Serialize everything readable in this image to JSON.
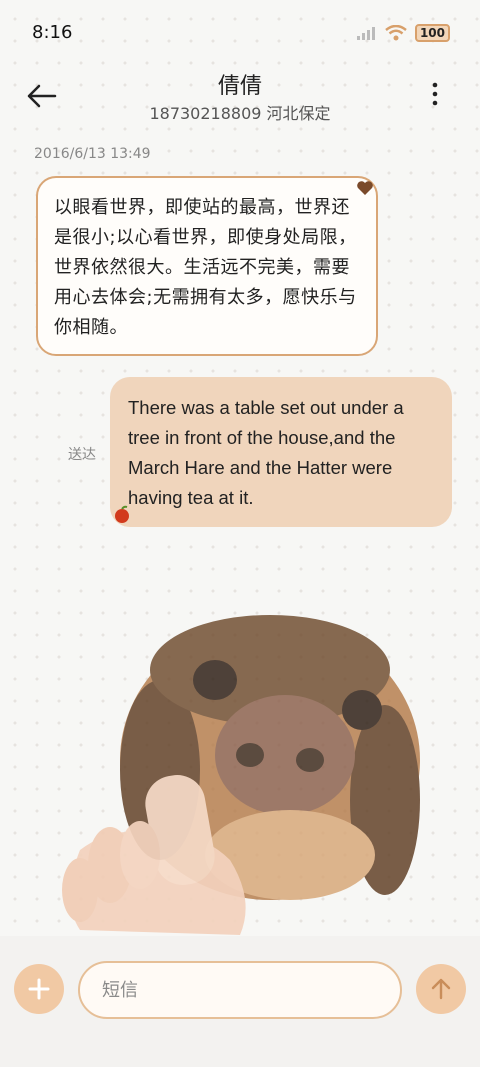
{
  "status_bar": {
    "time": "8:16",
    "battery": "100",
    "icons": [
      "signal-icon",
      "wifi-icon",
      "battery-icon"
    ]
  },
  "header": {
    "title": "倩倩",
    "subtitle": "18730218809 河北保定",
    "back_icon": "arrow-left-icon",
    "more_icon": "more-vertical-icon"
  },
  "messages": {
    "timestamp": "2016/6/13 13:49",
    "incoming_text": "以眼看世界，即使站的最高，世界还是很小;以心看世界，即使身处局限，世界依然很大。生活远不完美，需要用心去体会;无需拥有太多，愿快乐与你相随。",
    "outgoing_status": "送达",
    "outgoing_text": "There was a table set out under a tree in front of the house,and the March Hare and the Hatter were having tea at it."
  },
  "composer": {
    "placeholder": "短信",
    "add_icon": "plus-icon",
    "send_icon": "arrow-up-icon"
  },
  "colors": {
    "accent": "#f1c9a4",
    "bubble_border": "#d9a676",
    "outgoing_bubble": "#f0d5bc"
  }
}
